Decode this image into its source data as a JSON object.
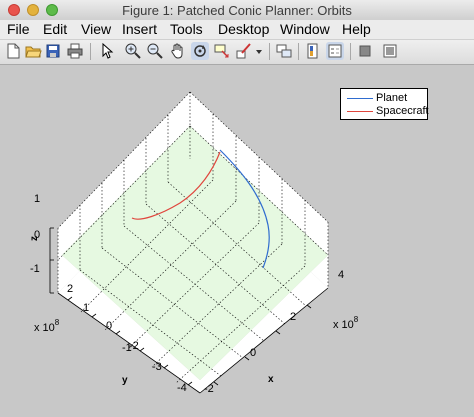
{
  "window": {
    "title": "Figure 1: Patched Conic Planner: Orbits"
  },
  "menu": [
    "File",
    "Edit",
    "View",
    "Insert",
    "Tools",
    "Desktop",
    "Window",
    "Help"
  ],
  "toolbar": {
    "icons": [
      "new-figure-icon",
      "open-file-icon",
      "save-icon",
      "print-icon",
      "pointer-icon",
      "zoom-in-icon",
      "zoom-out-icon",
      "pan-hand-icon",
      "rotate-3d-icon",
      "data-cursor-icon",
      "brush-icon",
      "brush-dropdown-icon",
      "link-plot-icon",
      "insert-colorbar-icon",
      "insert-legend-icon",
      "hide-plot-tools-icon",
      "show-plot-tools-icon"
    ]
  },
  "axes": {
    "x_label": "x",
    "y_label": "y",
    "z_label": "z",
    "x_multiplier": "x 10",
    "x_exponent": "8",
    "y_multiplier": "x 10",
    "y_exponent": "8",
    "x_ticks": [
      "-2",
      "0",
      "2",
      "4"
    ],
    "y_ticks": [
      "-4",
      "-3",
      "-2",
      "-1",
      "0",
      "1",
      "2"
    ],
    "z_ticks": [
      "1",
      "0",
      "-1"
    ],
    "colors": {
      "grid_plane": "#e6f9e1",
      "planet": "#2f6ccf",
      "spacecraft": "#e0463d",
      "background": "#c8c8c8",
      "axes_face": "#ffffff"
    }
  },
  "legend": {
    "entries": [
      {
        "name": "Planet",
        "color": "#2f6ccf"
      },
      {
        "name": "Spacecraft",
        "color": "#e0463d"
      }
    ],
    "placement": "top-right"
  }
}
